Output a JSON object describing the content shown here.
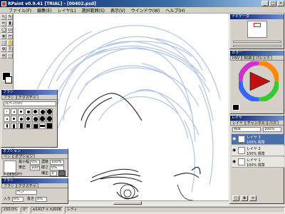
{
  "window": {
    "title": "RPaint v0.9.41 [TRIAL] - [00402.psd]"
  },
  "menu": [
    "ファイル(F)",
    "編集(E)",
    "レイヤ(L)",
    "選択範囲(S)",
    "表示(V)",
    "ウインドウ(W)",
    "ヘルプ(H)"
  ],
  "tools": [
    "↖",
    "✎",
    "✏",
    "▮",
    "◯",
    "▭",
    "◈",
    "✂",
    "⬚",
    "✋",
    "⊕",
    "T",
    "≡",
    "⋯"
  ],
  "brush_panel": {
    "title": "ブラシ",
    "tabs": [
      "ブラシ",
      "テクスチャ"
    ],
    "preset": "丸ペン(中)"
  },
  "option_panel": {
    "title": "オプション",
    "tabs": [
      "ペン",
      "オプション"
    ],
    "labels": [
      "最小幅",
      "濃度",
      "筆圧",
      "硬さ",
      "補正"
    ],
    "values": [
      "0%",
      "100%",
      "100%",
      "0%",
      "3"
    ],
    "checkbox": "P-DENSITY"
  },
  "bottom_panel": {
    "title": "ブラシ",
    "tabs": [
      "ブラシ",
      "テクスチャ"
    ],
    "fields": [
      "ペン",
      "入り",
      "0%",
      "抜き",
      "0%"
    ]
  },
  "navigator": {
    "title": "ナビゲータ"
  },
  "color_panel": {
    "title": "カラー",
    "tabs": [
      "HSV",
      "RGB",
      "パレット"
    ]
  },
  "layer_panel": {
    "title": "レイヤ",
    "tabs": [
      "レイヤ",
      "チャンネル",
      "パス"
    ],
    "mode": "標準",
    "opacity": "100%",
    "layers": [
      {
        "name": "レイヤ 3",
        "mode": "100% 標準",
        "selected": true
      },
      {
        "name": "レイヤ 2",
        "mode": "100% 標準",
        "selected": false
      },
      {
        "name": "レイヤ 1",
        "mode": "100% 標準",
        "selected": false
      }
    ]
  },
  "status": {
    "zoom": "150.0%",
    "angle": "0°",
    "size": "w1417 × h2008",
    "state": "レディ"
  },
  "colors": {
    "accent": "#0a246a",
    "panel": "#d4d0c8",
    "sketch": "#a9bfe3",
    "ink": "#1a1a1a"
  }
}
